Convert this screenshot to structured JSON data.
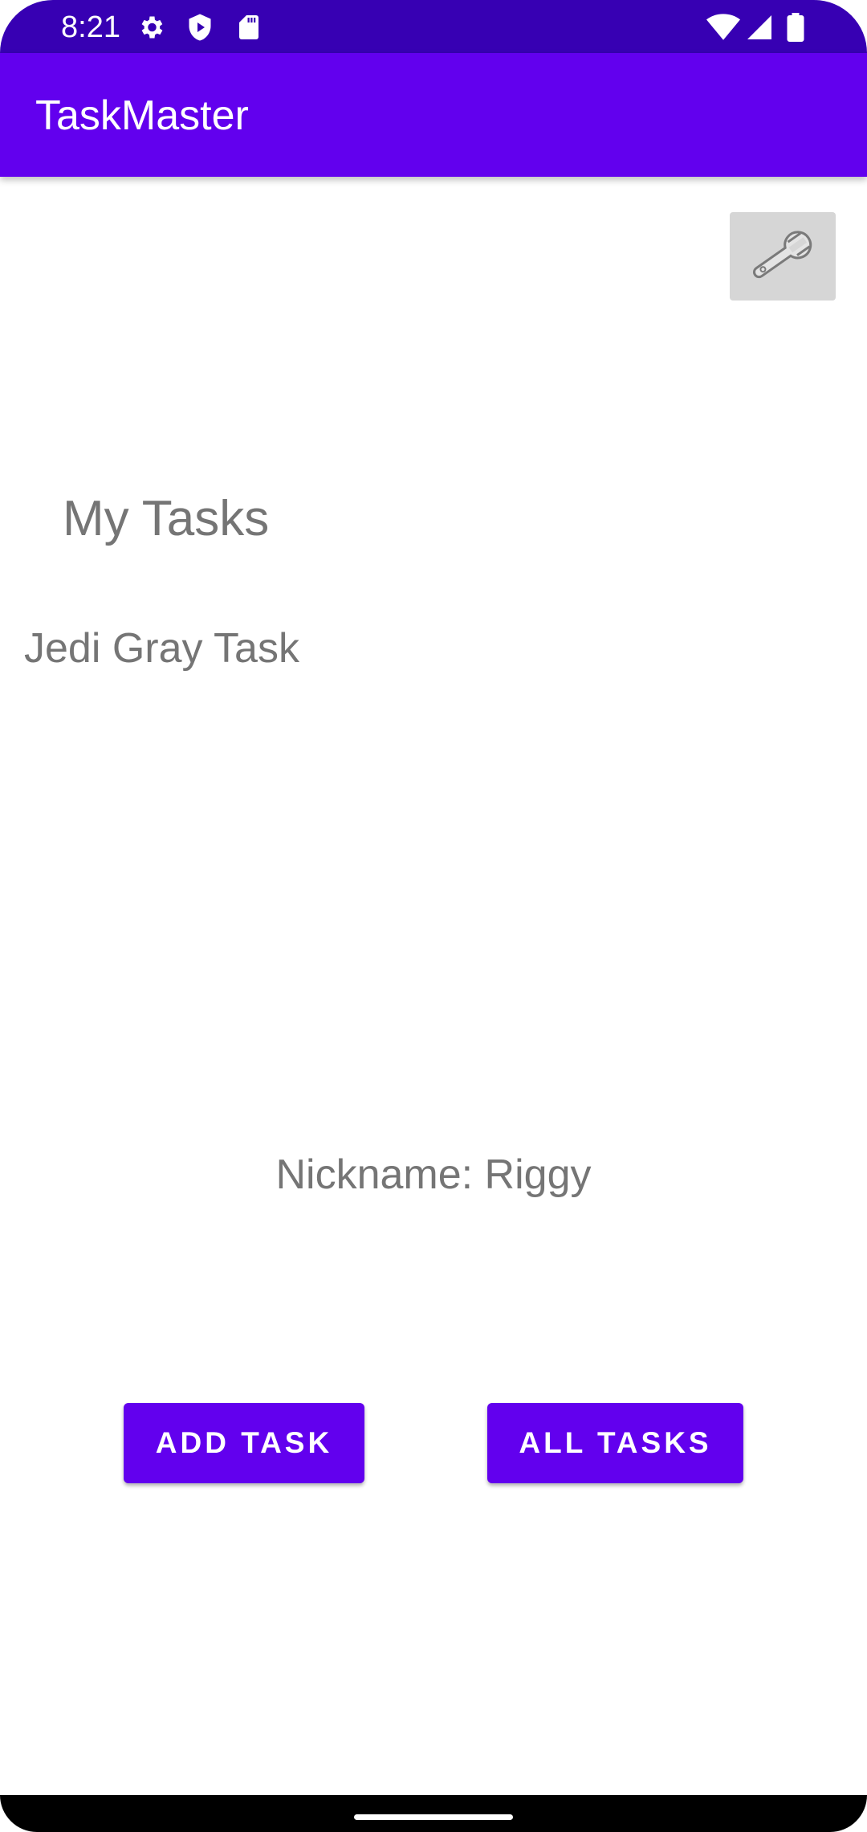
{
  "status_bar": {
    "time": "8:21",
    "left_icons": [
      "gear-icon",
      "shield-play-icon",
      "sd-card-icon"
    ],
    "right_icons": [
      "wifi-icon",
      "signal-icon",
      "battery-icon"
    ],
    "color": "#3700b3"
  },
  "app_bar": {
    "title": "TaskMaster",
    "color": "#6200ee"
  },
  "settings_button": {
    "icon": "wrench-icon"
  },
  "main": {
    "heading": "My Tasks",
    "tasks": [
      "Jedi Gray Task"
    ],
    "nickname": "Nickname: Riggy"
  },
  "buttons": {
    "add_task": "ADD TASK",
    "all_tasks": "ALL TASKS"
  }
}
